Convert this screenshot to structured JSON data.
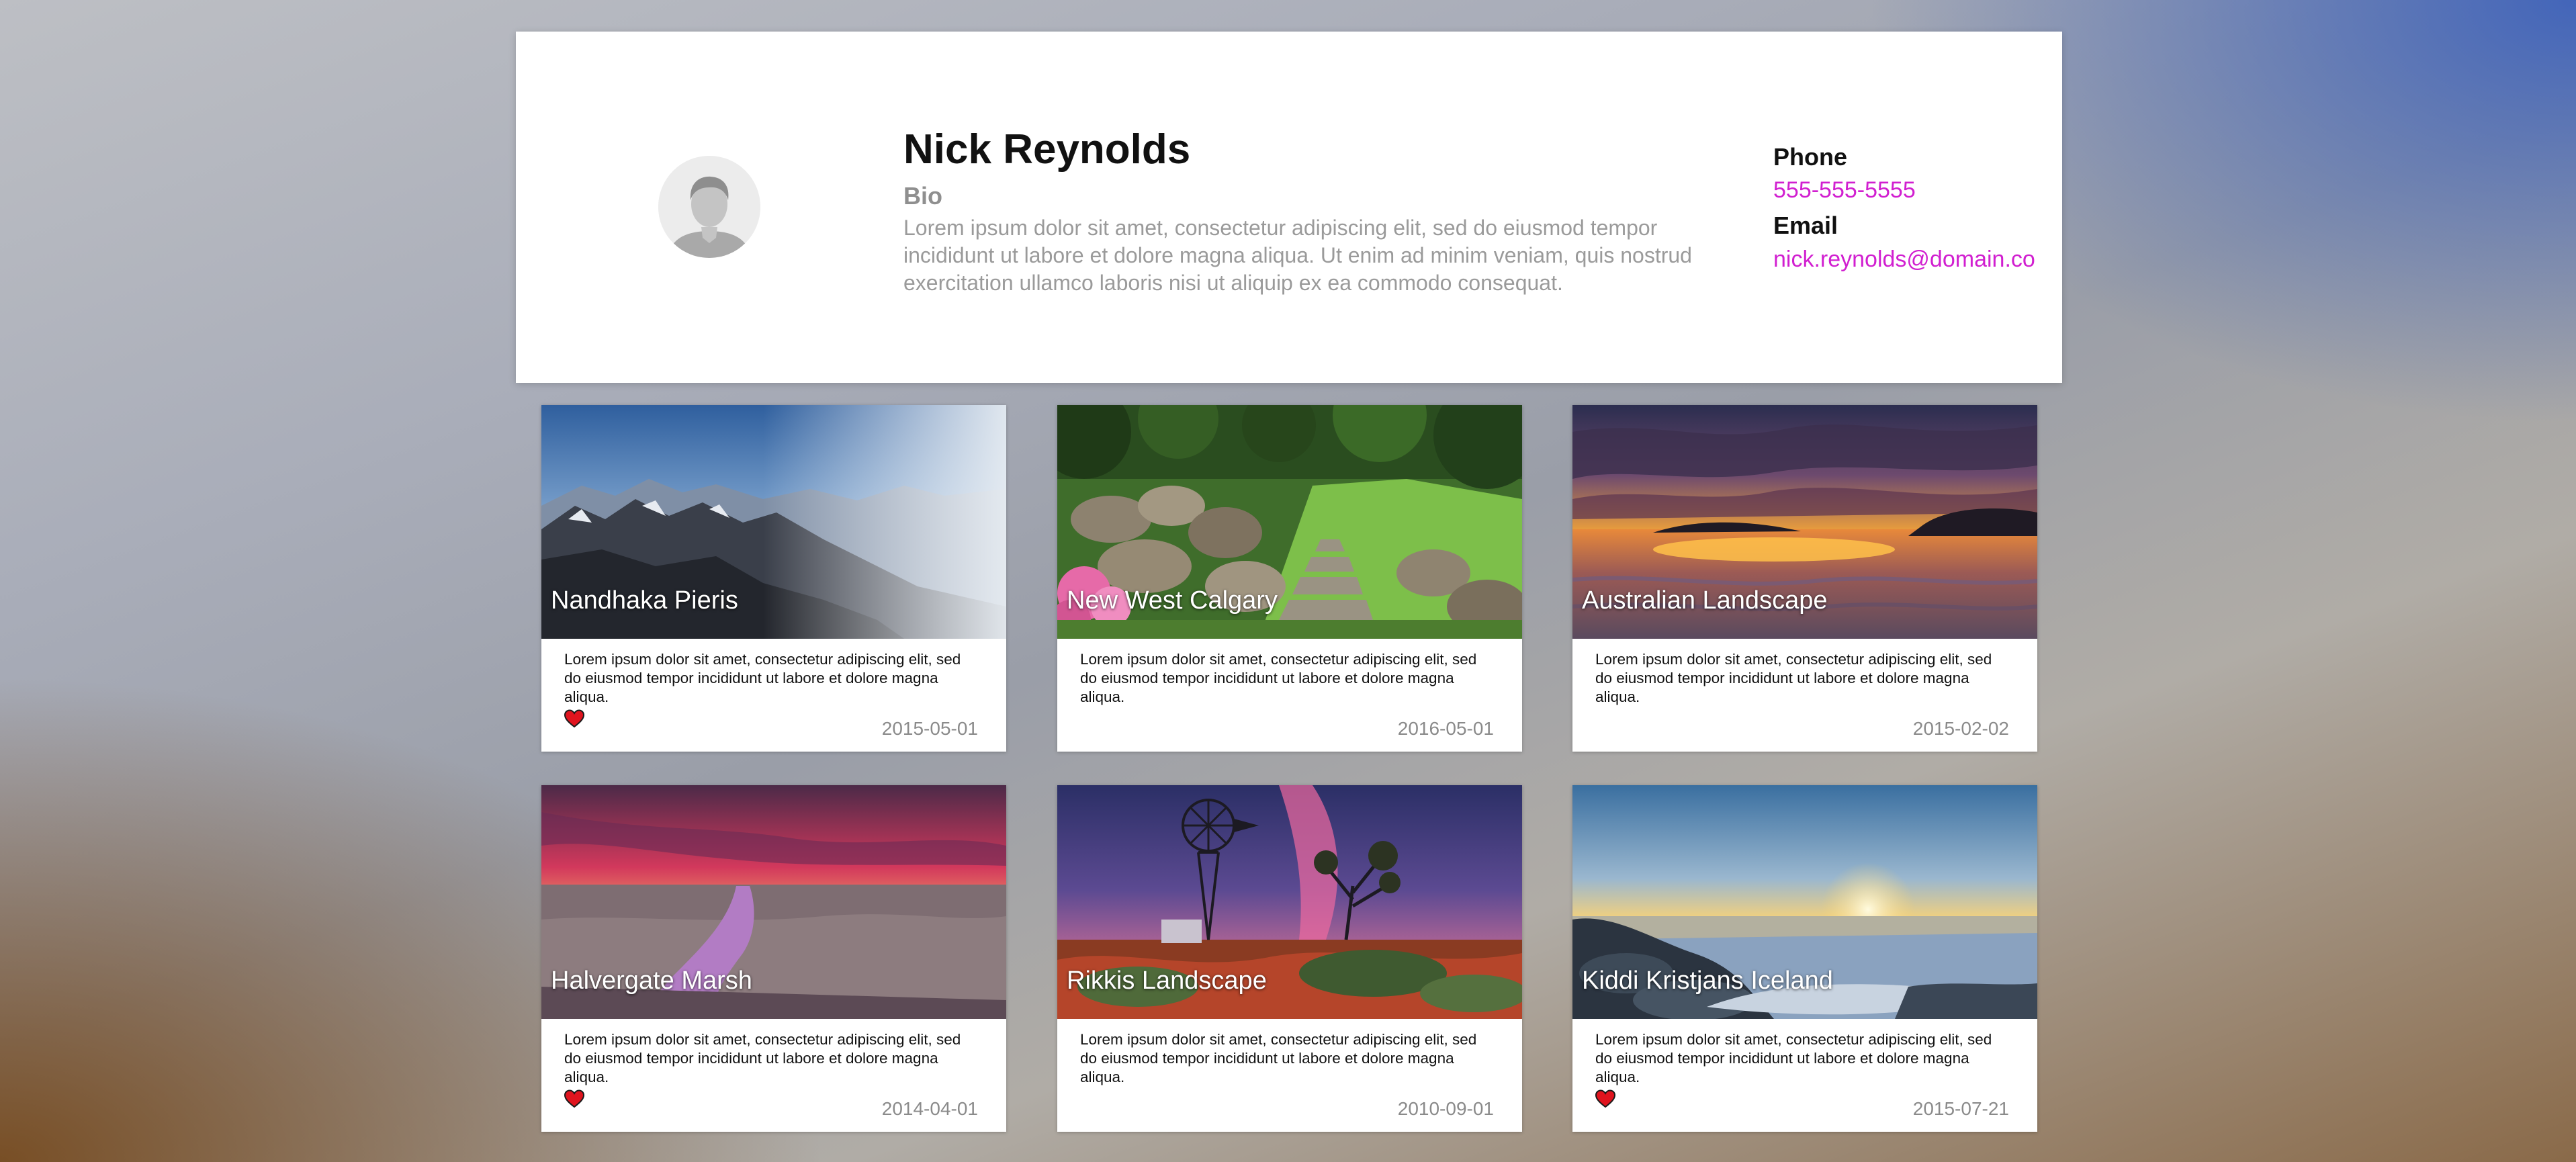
{
  "profile": {
    "name": "Nick Reynolds",
    "bio_label": "Bio",
    "bio_text": "Lorem ipsum dolor sit amet, consectetur adipiscing elit, sed do eiusmod tempor incididunt ut labore et dolore magna aliqua. Ut enim ad minim veniam, quis nostrud exercitation ullamco laboris nisi ut aliquip ex ea commodo consequat.",
    "phone_label": "Phone",
    "phone": "555-555-5555",
    "email_label": "Email",
    "email": "nick.reynolds@domain.co"
  },
  "colors": {
    "link": "#d11fd0",
    "heart": "#e0141e"
  },
  "cards": [
    {
      "title": "Nandhaka Pieris",
      "description": "Lorem ipsum dolor sit amet, consectetur adipiscing elit, sed do eiusmod tempor incididunt ut labore et dolore magna aliqua.",
      "date": "2015-05-01",
      "favorited": true,
      "icon": "heart-icon"
    },
    {
      "title": "New West Calgary",
      "description": "Lorem ipsum dolor sit amet, consectetur adipiscing elit, sed do eiusmod tempor incididunt ut labore et dolore magna aliqua.",
      "date": "2016-05-01",
      "favorited": false
    },
    {
      "title": "Australian Landscape",
      "description": "Lorem ipsum dolor sit amet, consectetur adipiscing elit, sed do eiusmod tempor incididunt ut labore et dolore magna aliqua.",
      "date": "2015-02-02",
      "favorited": false
    },
    {
      "title": "Halvergate Marsh",
      "description": "Lorem ipsum dolor sit amet, consectetur adipiscing elit, sed do eiusmod tempor incididunt ut labore et dolore magna aliqua.",
      "date": "2014-04-01",
      "favorited": true,
      "icon": "heart-icon"
    },
    {
      "title": "Rikkis Landscape",
      "description": "Lorem ipsum dolor sit amet, consectetur adipiscing elit, sed do eiusmod tempor incididunt ut labore et dolore magna aliqua.",
      "date": "2010-09-01",
      "favorited": false
    },
    {
      "title": "Kiddi Kristjans Iceland",
      "description": "Lorem ipsum dolor sit amet, consectetur adipiscing elit, sed do eiusmod tempor incididunt ut labore et dolore magna aliqua.",
      "date": "2015-07-21",
      "favorited": true,
      "icon": "heart-icon"
    }
  ]
}
